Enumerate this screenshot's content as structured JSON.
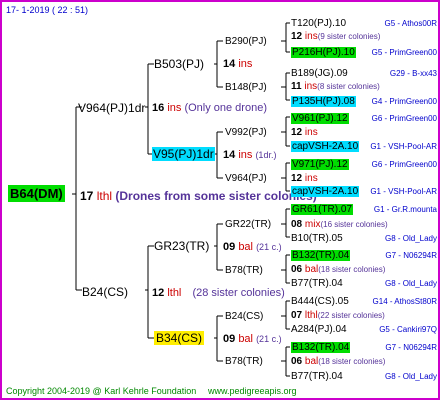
{
  "header": {
    "date": "17-   1-2019  ( 22 : 51)"
  },
  "footer": {
    "copyright": "Copyright 2004-2019 @ Karl Kehrle Foundation",
    "url": "www.pedigreeapis.org"
  },
  "root": {
    "name": "B64(DM)",
    "num": "17",
    "ins": "lthl",
    "note": "(Drones from some sister colonies)"
  },
  "gen1": {
    "top": {
      "name": "V964(PJ)1dr",
      "num": "16",
      "ins": "ins",
      "note": "(Only one drone)"
    },
    "bottom": {
      "name": "B24(CS)",
      "num": "12",
      "ins": "lthl",
      "note": "(28 sister colonies)"
    }
  },
  "gen2": {
    "a": {
      "name": "B503(PJ)",
      "num": "14",
      "ins": "ins"
    },
    "b": {
      "name": "V95(PJ)1dr",
      "num": "14",
      "ins": "ins",
      "note": "(1dr.)"
    },
    "c": {
      "name": "GR23(TR)",
      "num": "09",
      "ins": "bal",
      "note": "(21 c.)"
    },
    "d": {
      "name": "B34(CS)",
      "num": "09",
      "ins": "bal",
      "note": "(21 c.)"
    }
  },
  "gen3": {
    "a1": {
      "name": "B290(PJ)"
    },
    "a2": {
      "name": "B148(PJ)"
    },
    "b1": {
      "name": "V992(PJ)",
      "num": "12",
      "ins": "ins"
    },
    "b2": {
      "name": "V964(PJ)",
      "num": "12",
      "ins": "ins"
    },
    "c1": {
      "name": "GR22(TR)"
    },
    "c2": {
      "name": "B78(TR)"
    },
    "d1": {
      "name": "B24(CS)"
    },
    "d2": {
      "name": "B78(TR)"
    }
  },
  "gen4": [
    {
      "name": "T120(PJ).10",
      "right": "G5 - Athos00R"
    },
    {
      "num": "12",
      "ins": "ins",
      "note": "(9 sister colonies)"
    },
    {
      "name": "P216H(PJ).10",
      "right": "G5 - PrimGreen00"
    },
    {
      "name": "B189(JG).09",
      "right": "G29 - B-xx43"
    },
    {
      "num": "11",
      "ins": "ins",
      "note": "(8 sister colonies)"
    },
    {
      "name": "P135H(PJ).08",
      "right": "G4 - PrimGreen00"
    },
    {
      "name": "V961(PJ).12",
      "right": "G6 - PrimGreen00"
    },
    {
      "num": "12",
      "ins": "ins"
    },
    {
      "name": "capVSH-2A.10",
      "right": "G1 - VSH-Pool-AR"
    },
    {
      "name": "V971(PJ).12",
      "right": "G6 - PrimGreen00"
    },
    {
      "num": "12",
      "ins": "ins"
    },
    {
      "name": "capVSH-2A.10",
      "right": "G1 - VSH-Pool-AR"
    },
    {
      "name": "GR61(TR).07",
      "right": "G1 - Gr.R.mounta"
    },
    {
      "num": "08",
      "ins": "mix",
      "note": "(16 sister colonies)"
    },
    {
      "name": "B10(TR).05",
      "right": "G8 - Old_Lady"
    },
    {
      "name": "B132(TR).04",
      "right": "G7 - N06294R"
    },
    {
      "num": "06",
      "ins": "bal",
      "note": "(18 sister colonies)"
    },
    {
      "name": "B77(TR).04",
      "right": "G8 - Old_Lady"
    },
    {
      "name": "B444(CS).05",
      "right": "G14 - AthosSt80R"
    },
    {
      "num": "07",
      "ins": "lthl",
      "note": "(22 sister colonies)"
    },
    {
      "name": "A284(PJ).04",
      "right": "G5 - Cankiri97Q"
    },
    {
      "name": "B132(TR).04",
      "right": "G7 - N06294R"
    },
    {
      "num": "06",
      "ins": "bal",
      "note": "(18 sister colonies)"
    },
    {
      "name": "B77(TR).04",
      "right": "G8 - Old_Lady"
    }
  ]
}
